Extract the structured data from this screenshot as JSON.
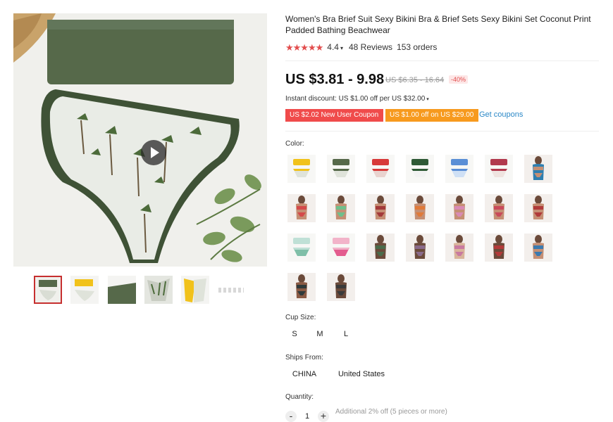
{
  "product": {
    "title": "Women's Bra Brief Suit Sexy Bikini Bra & Brief Sets Sexy Bikini Set Coconut Print Padded Bathing Beachwear",
    "rating": "4.4",
    "reviews": "48 Reviews",
    "orders": "153 orders",
    "star_icon": "star-icon",
    "rating_stars": 4.5,
    "price": "US $3.81 - 9.98",
    "old_price": "US $6.35 - 16.64",
    "discount": "-40%",
    "instant_discount": "Instant discount: US $1.00 off per US $32.00",
    "coupons": [
      "US $2.02 New User Coupon",
      "US $1.00 off on US $29.00"
    ],
    "get_coupons": "Get coupons"
  },
  "media": {
    "play_icon": "play-icon",
    "thumb_count": 5
  },
  "options": {
    "color_label": "Color:",
    "color_swatch_count": 23,
    "cup_label": "Cup Size:",
    "sizes": [
      "S",
      "M",
      "L"
    ],
    "ships_label": "Ships From:",
    "ships": [
      "CHINA",
      "United States"
    ],
    "quantity_label": "Quantity:",
    "quantity": "1",
    "minus": "-",
    "plus": "+",
    "quantity_note": "Additional 2% off (5 pieces or more)"
  },
  "colors": {
    "accent_red": "#e24d4d",
    "coupon_red": "#f04b4b",
    "coupon_orange": "#f79a1e",
    "link_blue": "#2b88c7",
    "bikini_green": "#56694a"
  }
}
